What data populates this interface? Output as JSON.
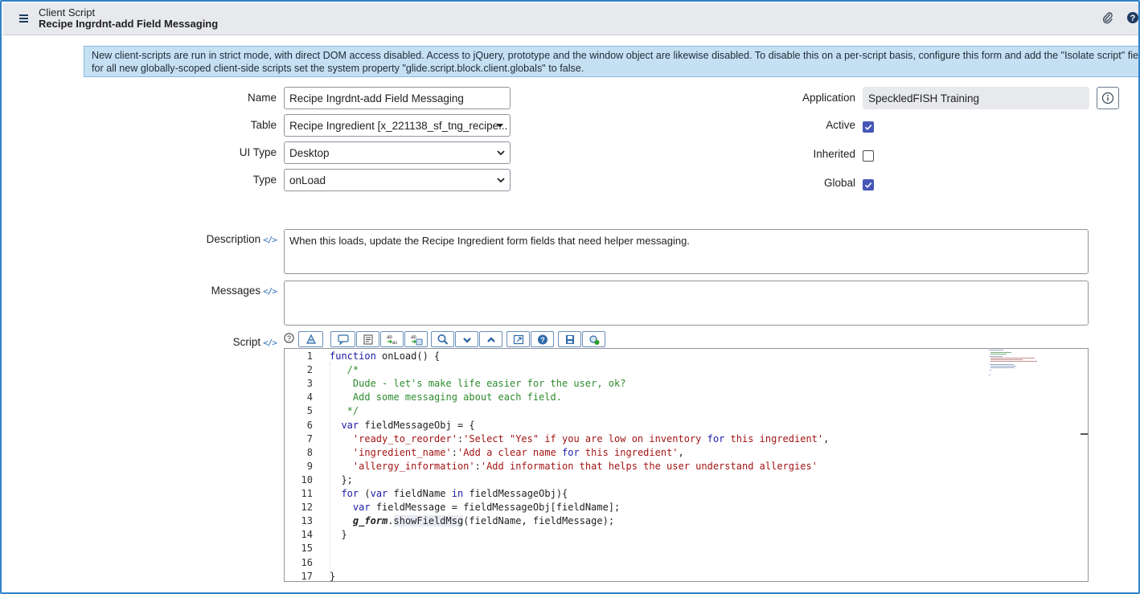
{
  "header": {
    "record_type": "Client Script",
    "record_title": "Recipe Ingrdnt-add Field Messaging"
  },
  "banner": {
    "line1": "New client-scripts are run in strict mode, with direct DOM access disabled. Access to jQuery, prototype and the window object are likewise disabled. To disable this on a per-script basis, configure this form and add the \"Isolate script\" field. To disable this feature",
    "line2": "for all new globally-scoped client-side scripts set the system property \"glide.script.block.client.globals\" to false."
  },
  "form": {
    "name_label": "Name",
    "name_value": "Recipe Ingrdnt-add Field Messaging",
    "table_label": "Table",
    "table_value": "Recipe Ingredient [x_221138_sf_tng_recipe...",
    "ui_type_label": "UI Type",
    "ui_type_value": "Desktop",
    "type_label": "Type",
    "type_value": "onLoad",
    "application_label": "Application",
    "application_value": "SpeckledFISH Training",
    "active_label": "Active",
    "active_checked": true,
    "inherited_label": "Inherited",
    "inherited_checked": false,
    "global_label": "Global",
    "global_checked": true,
    "description_label": "Description",
    "description_value": "When this loads, update the Recipe Ingredient form fields that need helper messaging.",
    "messages_label": "Messages",
    "messages_value": "",
    "script_label": "Script",
    "code_icon": "</>"
  },
  "icons": {
    "menu": "hamburger-icon",
    "attachment": "paperclip-icon",
    "help": "question-circle-icon",
    "info": "info-icon"
  },
  "colors": {
    "accent": "#4656b8",
    "banner_bg": "#c6e0f3",
    "header_bg": "#e7e9ed",
    "keyword": "#1a1aa6",
    "comment": "#2e8b2e",
    "string": "#a31515"
  },
  "script": {
    "lines": [
      {
        "n": "1",
        "text": "function onLoad() {"
      },
      {
        "n": "2",
        "text": "   /*"
      },
      {
        "n": "3",
        "text": "    Dude - let's make life easier for the user, ok?"
      },
      {
        "n": "4",
        "text": "    Add some messaging about each field."
      },
      {
        "n": "5",
        "text": "   */"
      },
      {
        "n": "6",
        "text": "  var fieldMessageObj = {"
      },
      {
        "n": "7",
        "text": "    'ready_to_reorder':'Select \"Yes\" if you are low on inventory for this ingredient',"
      },
      {
        "n": "8",
        "text": "    'ingredient_name':'Add a clear name for this ingredient',"
      },
      {
        "n": "9",
        "text": "    'allergy_information':'Add information that helps the user understand allergies'"
      },
      {
        "n": "10",
        "text": "  };"
      },
      {
        "n": "11",
        "text": "  for (var fieldName in fieldMessageObj){"
      },
      {
        "n": "12",
        "text": "    var fieldMessage = fieldMessageObj[fieldName];"
      },
      {
        "n": "13",
        "text": "    g_form.showFieldMsg(fieldName, fieldMessage);"
      },
      {
        "n": "14",
        "text": "  }"
      },
      {
        "n": "15",
        "text": ""
      },
      {
        "n": "16",
        "text": ""
      },
      {
        "n": "17",
        "text": "}"
      }
    ]
  },
  "toolbar": [
    {
      "icon": "toggle-syntax-editor-icon"
    },
    {
      "icon": "comment-icon"
    },
    {
      "icon": "format-code-icon"
    },
    {
      "icon": "replace-icon"
    },
    {
      "icon": "replace-all-icon"
    },
    {
      "icon": "search-icon"
    },
    {
      "icon": "collapse-icon"
    },
    {
      "icon": "expand-icon"
    },
    {
      "icon": "fullscreen-icon"
    },
    {
      "icon": "help-icon"
    },
    {
      "icon": "save-icon"
    },
    {
      "icon": "script-debugger-icon"
    }
  ]
}
